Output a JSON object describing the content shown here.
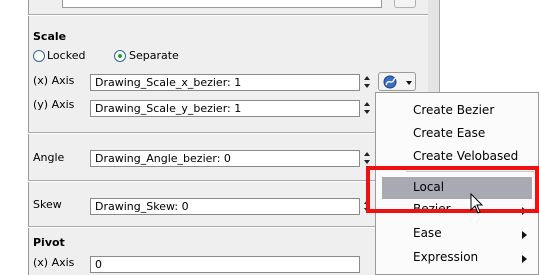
{
  "scale": {
    "title": "Scale",
    "mode_options": [
      "Locked",
      "Separate"
    ],
    "x_axis": {
      "label": "(x) Axis",
      "value": "Drawing_Scale_x_bezier: 1"
    },
    "y_axis": {
      "label": "(y) Axis",
      "value": "Drawing_Scale_y_bezier: 1"
    }
  },
  "angle": {
    "label": "Angle",
    "value": "Drawing_Angle_bezier: 0"
  },
  "skew": {
    "label": "Skew",
    "value": "Drawing_Skew: 0"
  },
  "pivot": {
    "title": "Pivot",
    "x_axis": {
      "label": "(x) Axis",
      "value": "0"
    }
  },
  "context_menu": {
    "items": [
      "Create Bezier",
      "Create Ease",
      "Create Velobased",
      "Local",
      "Bezier",
      "Ease",
      "Expression"
    ],
    "highlighted": "Local",
    "highlight_color": "#a9a9b4",
    "callout_color": "#ee1111"
  }
}
